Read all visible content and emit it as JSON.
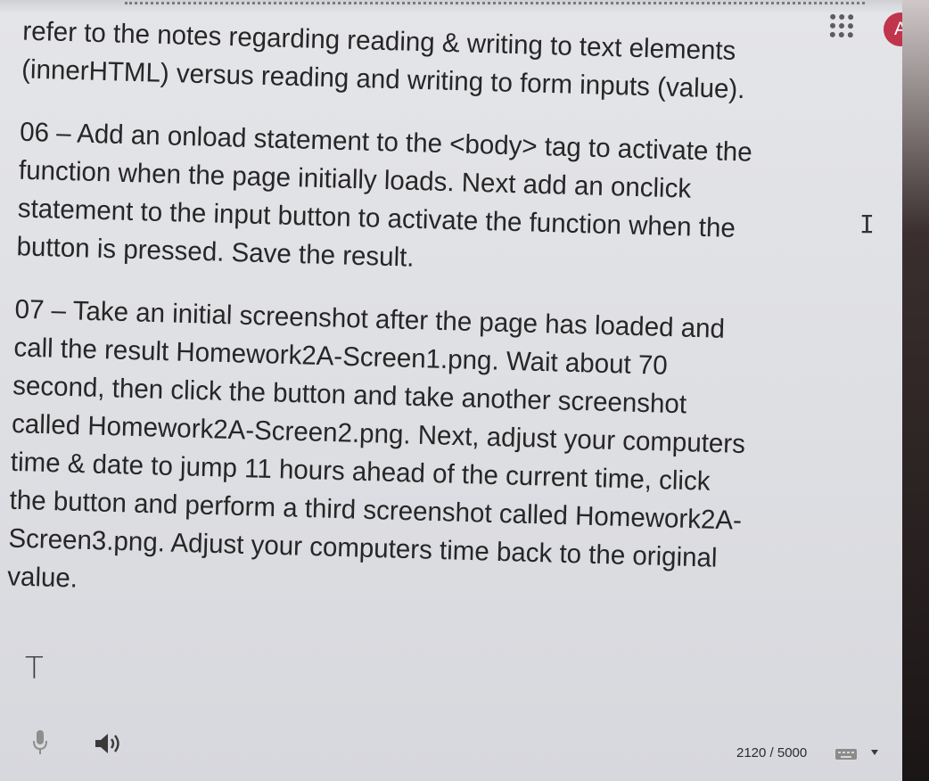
{
  "header": {
    "avatar_letter": "A",
    "apps_icon": "apps-grid-icon"
  },
  "document": {
    "lines": [
      "refer to the notes regarding reading & writing to text elements",
      "(innerHTML) versus reading and writing to form inputs (value).",
      "06 – Add an onload statement to the <body> tag to activate the",
      "function when the page initially loads. Next add an onclick",
      "statement to the input button to activate the function when the",
      "button is pressed. Save the result.",
      "07 – Take an initial screenshot after the page has loaded and",
      "call the result Homework2A-Screen1.png. Wait about 70",
      "second, then click the button and take another screenshot",
      "called Homework2A-Screen2.png. Next, adjust your computers",
      "time & date to jump 11 hours ahead of the current time, click",
      "the button and perform a third screenshot called Homework2A-",
      "Screen3.png. Adjust your computers time back to the original",
      "value."
    ],
    "text_cursor": "T"
  },
  "footer": {
    "char_count": "2120 / 5000",
    "icons": [
      "microphone-icon",
      "speaker-icon",
      "keyboard-icon",
      "dropdown-arrow-icon"
    ]
  },
  "colors": {
    "avatar_bg": "#c0344c",
    "page_bg": "#e2e3e6",
    "text": "#262626"
  }
}
